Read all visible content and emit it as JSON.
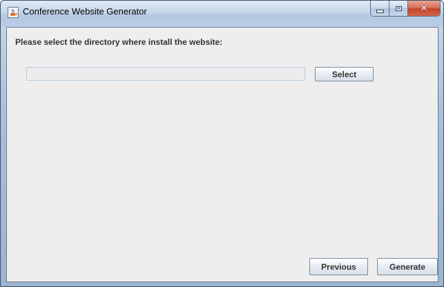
{
  "window": {
    "title": "Conference Website Generator",
    "icon": "java-cup-icon",
    "controls": {
      "minimize": "minimize-icon",
      "maximize": "maximize-icon",
      "close": "close-icon"
    }
  },
  "main": {
    "prompt": "Please select the directory where install the website:",
    "directory_input": {
      "value": "",
      "placeholder": ""
    },
    "select_label": "Select"
  },
  "footer": {
    "previous_label": "Previous",
    "generate_label": "Generate"
  },
  "colors": {
    "client_bg": "#eeeeee",
    "button_border": "#7a8a99",
    "input_border": "#b8cfe5",
    "close_button": "#c4452a"
  }
}
